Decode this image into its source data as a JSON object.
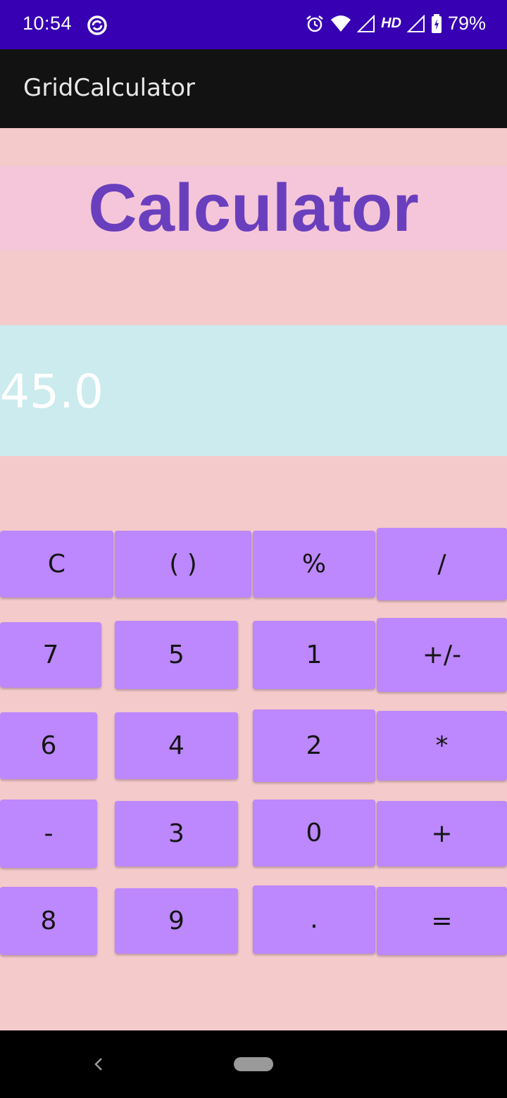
{
  "status_bar": {
    "time": "10:54",
    "network_label": "HD",
    "battery": "79%",
    "icons": [
      "sync-icon",
      "alarm-icon",
      "wifi-icon",
      "signal-icon",
      "battery-icon"
    ]
  },
  "app_bar": {
    "title": "GridCalculator"
  },
  "heading": {
    "text": "Calculator"
  },
  "display": {
    "value": "45.0"
  },
  "keypad": {
    "keys": [
      "C",
      "( )",
      "%",
      "/",
      "7",
      "5",
      "1",
      "+/-",
      "6",
      "4",
      "2",
      "*",
      "-",
      "3",
      "0",
      "+",
      "8",
      "9",
      ".",
      "="
    ]
  },
  "colors": {
    "status_bar": "#3700b3",
    "app_bar": "#121212",
    "background": "#f5cacb",
    "heading_band": "#f5c6d9",
    "heading_text": "#6a3fbd",
    "display_band": "#cbebee",
    "key": "#bd87fd"
  }
}
